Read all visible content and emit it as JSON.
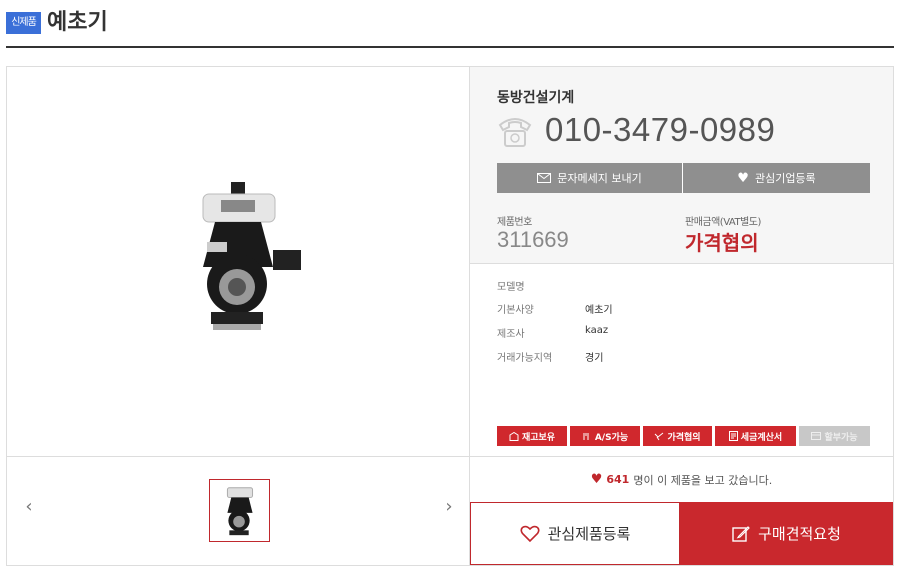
{
  "header": {
    "badge": "신제품",
    "title": "예초기"
  },
  "seller": {
    "company": "동방건설기계",
    "phone": "010-3479-0989",
    "message_button": "문자메세지 보내기",
    "favorite_company_button": "관심기업등록"
  },
  "product": {
    "number_label": "제품번호",
    "number": "311669",
    "price_label": "판매금액(VAT별도)",
    "price": "가격협의"
  },
  "specs": [
    {
      "key": "모델명",
      "value": ""
    },
    {
      "key": "기본사양",
      "value": "예초기"
    },
    {
      "key": "제조사",
      "value": "kaaz"
    },
    {
      "key": "거래가능지역",
      "value": "경기"
    }
  ],
  "tags": [
    {
      "label": "재고보유",
      "icon": "store-icon",
      "active": true
    },
    {
      "label": "A/S가능",
      "icon": "wrench-icon",
      "active": true
    },
    {
      "label": "가격협의",
      "icon": "handshake-icon",
      "active": true
    },
    {
      "label": "세금계산서",
      "icon": "receipt-icon",
      "active": true
    },
    {
      "label": "할부가능",
      "icon": "card-icon",
      "active": false
    }
  ],
  "views": {
    "count": "641",
    "text": "명이 이 제품을 보고 갔습니다."
  },
  "actions": {
    "wish": "관심제품등록",
    "quote": "구매견적요청"
  },
  "colors": {
    "accent": "#c9282d",
    "badge": "#3a6fd8",
    "gray_button": "#8f8f8f"
  }
}
